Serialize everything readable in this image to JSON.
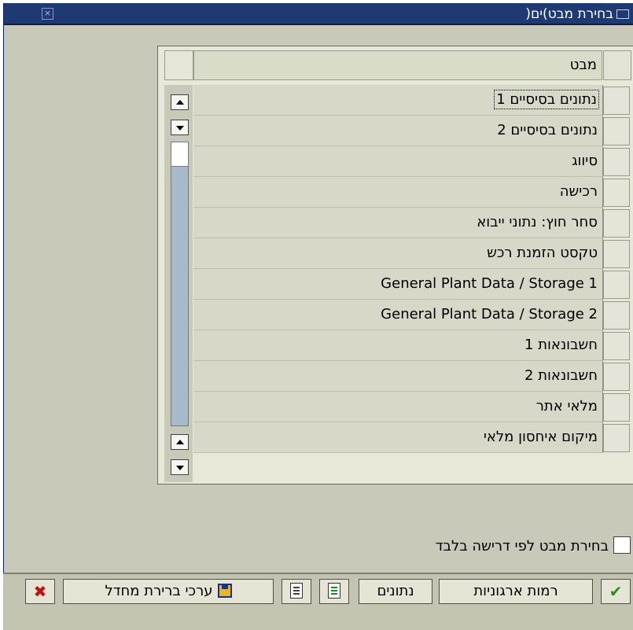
{
  "window": {
    "title": "בחירת מבט)ים("
  },
  "list": {
    "header": "מבט",
    "items": [
      "נתונים בסיסיים 1",
      "נתונים בסיסיים 2",
      "סיווג",
      "רכישה",
      "סחר חוץ: נתוני ייבוא",
      "טקסט הזמנת רכש",
      "General Plant Data / Storage 1",
      "General Plant Data / Storage 2",
      "חשבונאות 1",
      "חשבונאות 2",
      "מלאי אתר",
      "מיקום איחסון מלאי"
    ]
  },
  "options": {
    "select_by_requirement_label": "בחירת מבט לפי דרישה בלבד"
  },
  "footer": {
    "org_levels_label": "רמות ארגוניות",
    "data_label": "נתונים",
    "default_values_label": "ערכי ברירת מחדל"
  },
  "icons": {
    "confirm": "check-icon",
    "cancel": "x-icon",
    "save": "save-icon",
    "select_all": "select-all-icon",
    "deselect_all": "deselect-all-icon"
  },
  "colors": {
    "titlebar": "#1f3a72",
    "background": "#c8c9b8",
    "scroll_track": "#a9b9cc"
  }
}
